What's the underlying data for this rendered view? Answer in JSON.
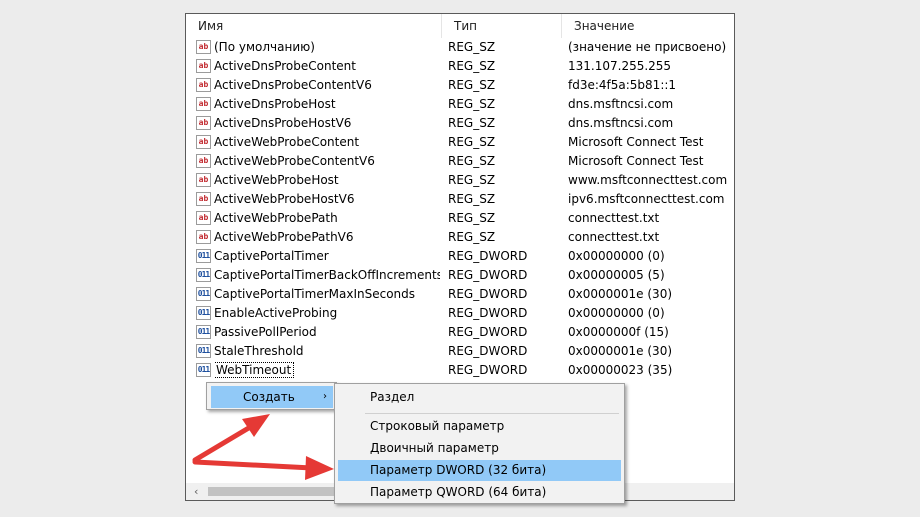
{
  "columns": {
    "name": "Имя",
    "type": "Тип",
    "value": "Значение"
  },
  "rows": [
    {
      "icon": "string-value-icon",
      "name": "(По умолчанию)",
      "type": "REG_SZ",
      "value": "(значение не присвоено)"
    },
    {
      "icon": "string-value-icon",
      "name": "ActiveDnsProbeContent",
      "type": "REG_SZ",
      "value": "131.107.255.255"
    },
    {
      "icon": "string-value-icon",
      "name": "ActiveDnsProbeContentV6",
      "type": "REG_SZ",
      "value": "fd3e:4f5a:5b81::1"
    },
    {
      "icon": "string-value-icon",
      "name": "ActiveDnsProbeHost",
      "type": "REG_SZ",
      "value": "dns.msftncsi.com"
    },
    {
      "icon": "string-value-icon",
      "name": "ActiveDnsProbeHostV6",
      "type": "REG_SZ",
      "value": "dns.msftncsi.com"
    },
    {
      "icon": "string-value-icon",
      "name": "ActiveWebProbeContent",
      "type": "REG_SZ",
      "value": "Microsoft Connect Test"
    },
    {
      "icon": "string-value-icon",
      "name": "ActiveWebProbeContentV6",
      "type": "REG_SZ",
      "value": "Microsoft Connect Test"
    },
    {
      "icon": "string-value-icon",
      "name": "ActiveWebProbeHost",
      "type": "REG_SZ",
      "value": "www.msftconnecttest.com"
    },
    {
      "icon": "string-value-icon",
      "name": "ActiveWebProbeHostV6",
      "type": "REG_SZ",
      "value": "ipv6.msftconnecttest.com"
    },
    {
      "icon": "string-value-icon",
      "name": "ActiveWebProbePath",
      "type": "REG_SZ",
      "value": "connecttest.txt"
    },
    {
      "icon": "string-value-icon",
      "name": "ActiveWebProbePathV6",
      "type": "REG_SZ",
      "value": "connecttest.txt"
    },
    {
      "icon": "dword-value-icon",
      "name": "CaptivePortalTimer",
      "type": "REG_DWORD",
      "value": "0x00000000 (0)"
    },
    {
      "icon": "dword-value-icon",
      "name": "CaptivePortalTimerBackOffIncrementsIn...",
      "type": "REG_DWORD",
      "value": "0x00000005 (5)"
    },
    {
      "icon": "dword-value-icon",
      "name": "CaptivePortalTimerMaxInSeconds",
      "type": "REG_DWORD",
      "value": "0x0000001e (30)"
    },
    {
      "icon": "dword-value-icon",
      "name": "EnableActiveProbing",
      "type": "REG_DWORD",
      "value": "0x00000000 (0)"
    },
    {
      "icon": "dword-value-icon",
      "name": "PassivePollPeriod",
      "type": "REG_DWORD",
      "value": "0x0000000f (15)"
    },
    {
      "icon": "dword-value-icon",
      "name": "StaleThreshold",
      "type": "REG_DWORD",
      "value": "0x0000001e (30)"
    },
    {
      "icon": "dword-value-icon",
      "name": "WebTimeout",
      "type": "REG_DWORD",
      "value": "0x00000023 (35)"
    }
  ],
  "icon_text": {
    "string": "ab",
    "dword": "011"
  },
  "context_menu": {
    "create_label": "Создать",
    "submenu_arrow": "›"
  },
  "submenu": {
    "key": "Раздел",
    "string_param": "Строковый параметр",
    "binary_param": "Двоичный параметр",
    "dword_param": "Параметр DWORD (32 бита)",
    "qword_param": "Параметр QWORD (64 бита)"
  },
  "scrollbar": {
    "left_arrow": "‹"
  },
  "colors": {
    "highlight": "#91c9f7",
    "annotation_arrow": "#e53935"
  }
}
